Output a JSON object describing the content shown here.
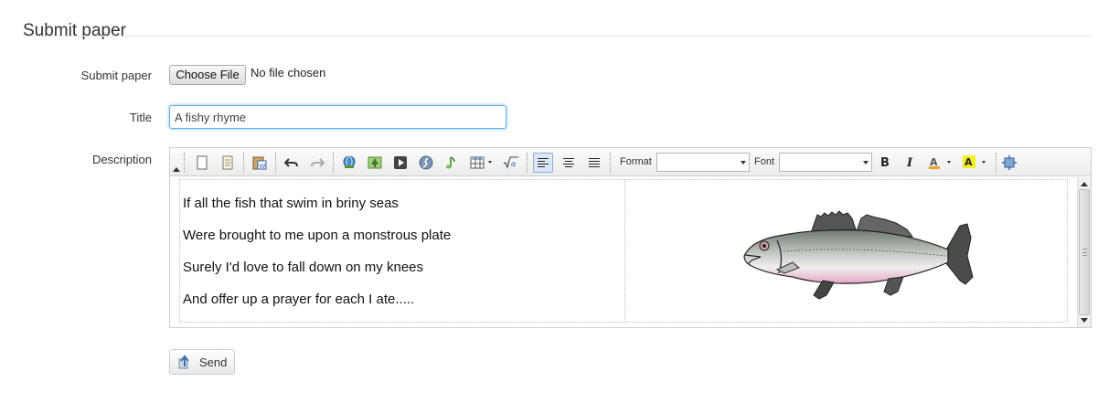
{
  "page": {
    "title": "Submit paper"
  },
  "form": {
    "file_label": "Submit paper",
    "file_button_label": "Choose File",
    "file_status": "No file chosen",
    "title_label": "Title",
    "title_value": "A fishy rhyme",
    "description_label": "Description",
    "send_label": "Send"
  },
  "editor": {
    "toolbar": {
      "buttons": [
        "new-page-icon",
        "templates-icon",
        "paste-from-word-icon",
        "undo-icon",
        "redo-icon",
        "link-icon",
        "image-icon",
        "video-icon",
        "flash-icon",
        "audio-icon",
        "table-icon",
        "math-icon",
        "align-left-icon",
        "align-center-icon",
        "justify-icon",
        "bold-icon",
        "italic-icon",
        "text-color-icon",
        "background-color-icon",
        "maximize-icon"
      ],
      "format_label": "Format",
      "format_value": "",
      "font_label": "Font",
      "font_value": "",
      "active_button": "align-left-icon"
    },
    "content": {
      "poem_lines": [
        " If all the fish that swim in briny seas",
        "Were brought to me upon a monstrous plate",
        "Surely I'd love to fall down on my knees",
        "And offer up a prayer for each I ate....."
      ],
      "image": "fish-illustration"
    }
  },
  "colors": {
    "focus_border": "#66afe9",
    "active_tool_bg": "#dbe6f6",
    "fish_belly": "#e8a6c6"
  }
}
